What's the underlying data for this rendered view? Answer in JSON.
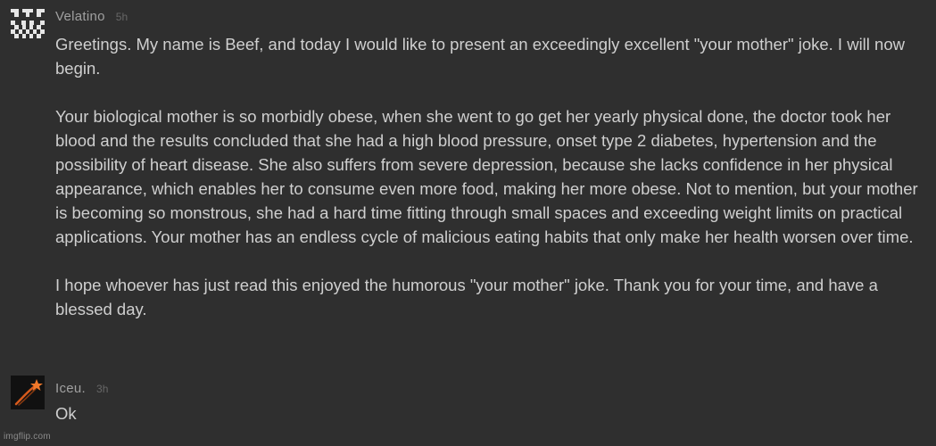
{
  "comments": [
    {
      "username": "Velatino",
      "time": "5h",
      "avatar": "pixel-pattern-avatar",
      "text": "Greetings. My name is Beef, and today I would like to present an exceedingly excellent \"your mother\" joke. I will now begin.\n\nYour biological mother is so morbidly obese, when she went to go get her yearly physical done, the doctor took her blood and the results concluded that she had a high blood pressure, onset type 2 diabetes, hypertension and the possibility of heart disease. She also suffers from severe depression, because she lacks confidence in her physical appearance, which enables her to consume even more food, making her more obese. Not to mention, but your mother is becoming so monstrous, she had a hard time fitting through small spaces and exceeding weight limits on practical applications. Your mother has an endless cycle of malicious eating habits that only make her health worsen over time.\n\nI hope whoever has just read this enjoyed the humorous \"your mother\" joke. Thank you for your time, and have a blessed day."
    },
    {
      "username": "Iceu.",
      "time": "3h",
      "avatar": "shooting-star-avatar",
      "text": "Ok"
    }
  ],
  "watermark": "imgflip.com",
  "colors": {
    "background": "#2f2f2f",
    "username": "#a0a0a0",
    "timestamp": "#676767",
    "body_text": "#cfcfcf",
    "star_orange": "#f0782a"
  }
}
